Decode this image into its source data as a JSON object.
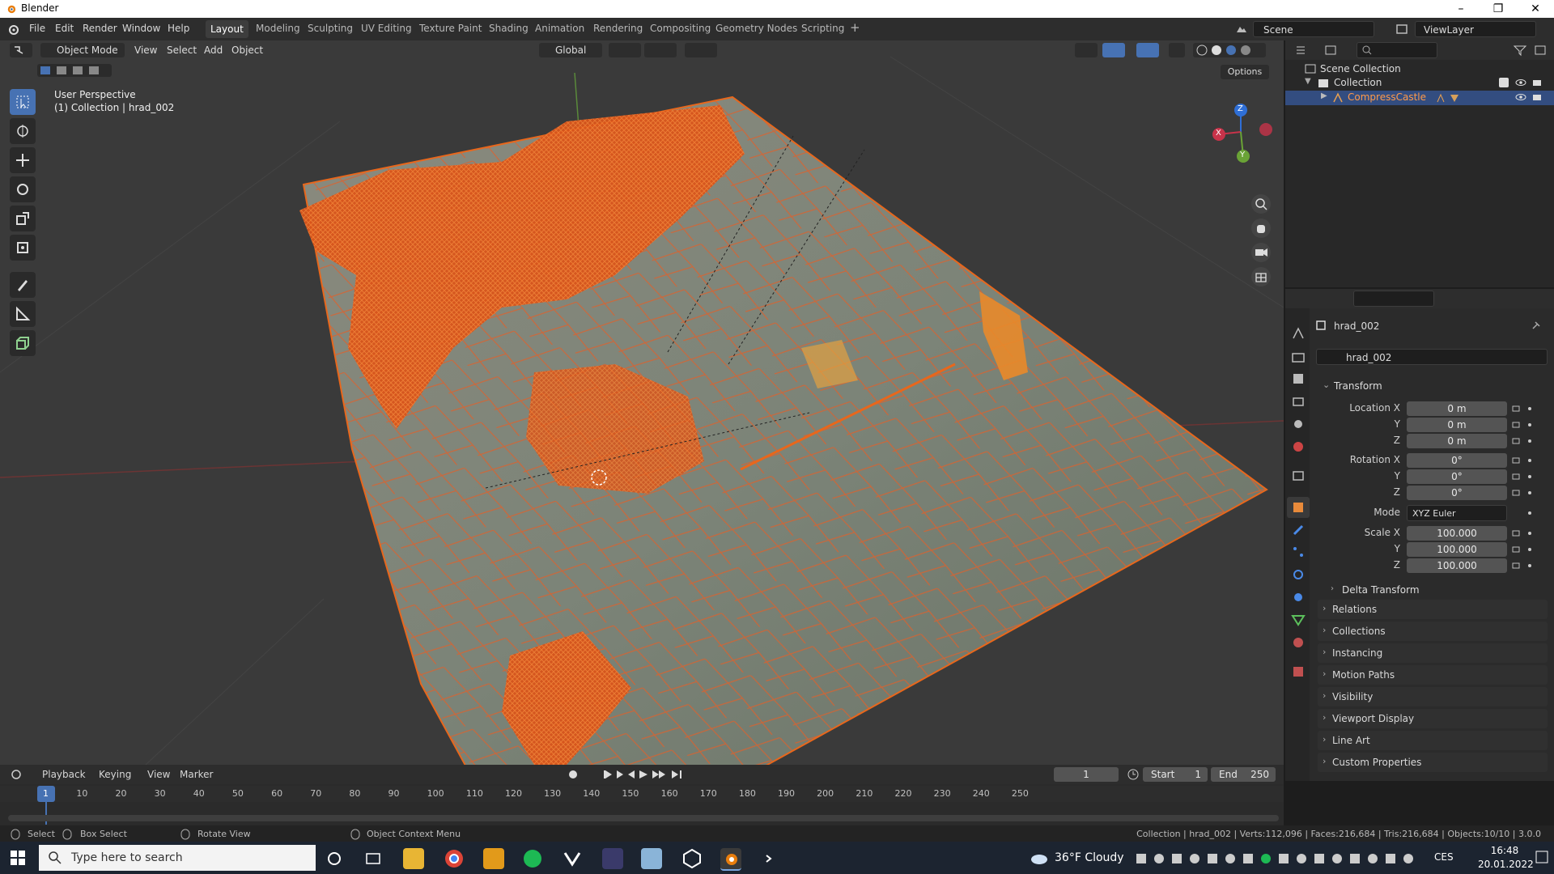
{
  "window": {
    "title": "Blender"
  },
  "menus": [
    "File",
    "Edit",
    "Render",
    "Window",
    "Help"
  ],
  "workspaces": [
    "Layout",
    "Modeling",
    "Sculpting",
    "UV Editing",
    "Texture Paint",
    "Shading",
    "Animation",
    "Rendering",
    "Compositing",
    "Geometry Nodes",
    "Scripting"
  ],
  "scene": {
    "name": "Scene",
    "view_layer": "ViewLayer"
  },
  "viewport_header": {
    "mode": "Object Mode",
    "menu": [
      "View",
      "Select",
      "Add",
      "Object"
    ],
    "orientation": "Global",
    "options": "Options"
  },
  "viewport_overlay": {
    "perspective": "User Perspective",
    "collection_info": "(1) Collection | hrad_002"
  },
  "gizmo": {
    "x": "X",
    "y": "Y",
    "z": "Z"
  },
  "outliner": {
    "root": "Scene Collection",
    "collection": "Collection",
    "object": "CompressCastle"
  },
  "properties": {
    "object_name": "hrad_002",
    "data_name": "hrad_002",
    "transform_title": "Transform",
    "location_label": "Location X",
    "rotation_label": "Rotation X",
    "scale_label": "Scale X",
    "y_label": "Y",
    "z_label": "Z",
    "location": [
      "0 m",
      "0 m",
      "0 m"
    ],
    "rotation": [
      "0°",
      "0°",
      "0°"
    ],
    "mode_label": "Mode",
    "mode_value": "XYZ Euler",
    "scale": [
      "100.000",
      "100.000",
      "100.000"
    ],
    "delta_transform": "Delta Transform",
    "sections": [
      "Relations",
      "Collections",
      "Instancing",
      "Motion Paths",
      "Visibility",
      "Viewport Display",
      "Line Art",
      "Custom Properties"
    ]
  },
  "timeline": {
    "menu": [
      "Playback",
      "Keying",
      "View",
      "Marker"
    ],
    "current_frame": "1",
    "start_label": "Start",
    "start": "1",
    "end_label": "End",
    "end": "250",
    "ticks": [
      "1",
      "10",
      "20",
      "30",
      "40",
      "50",
      "60",
      "70",
      "80",
      "90",
      "100",
      "110",
      "120",
      "130",
      "140",
      "150",
      "160",
      "170",
      "180",
      "190",
      "200",
      "210",
      "220",
      "230",
      "240",
      "250"
    ]
  },
  "statusbar": {
    "select": "Select",
    "box_select": "Box Select",
    "rotate_view": "Rotate View",
    "context_menu": "Object Context Menu",
    "stats": "Collection | hrad_002 | Verts:112,096 | Faces:216,684 | Tris:216,684 | Objects:10/10 | 3.0.0"
  },
  "taskbar": {
    "search_placeholder": "Type here to search",
    "weather": "36°F Cloudy",
    "lang": "CES",
    "time": "16:48",
    "date": "20.01.2022"
  },
  "colors": {
    "accent": "#4772b3",
    "selection_orange": "#e8671c",
    "header_bg": "#2d2d2d",
    "panel_bg": "#2b2b2b",
    "viewport_bg": "#3a3a3a"
  }
}
